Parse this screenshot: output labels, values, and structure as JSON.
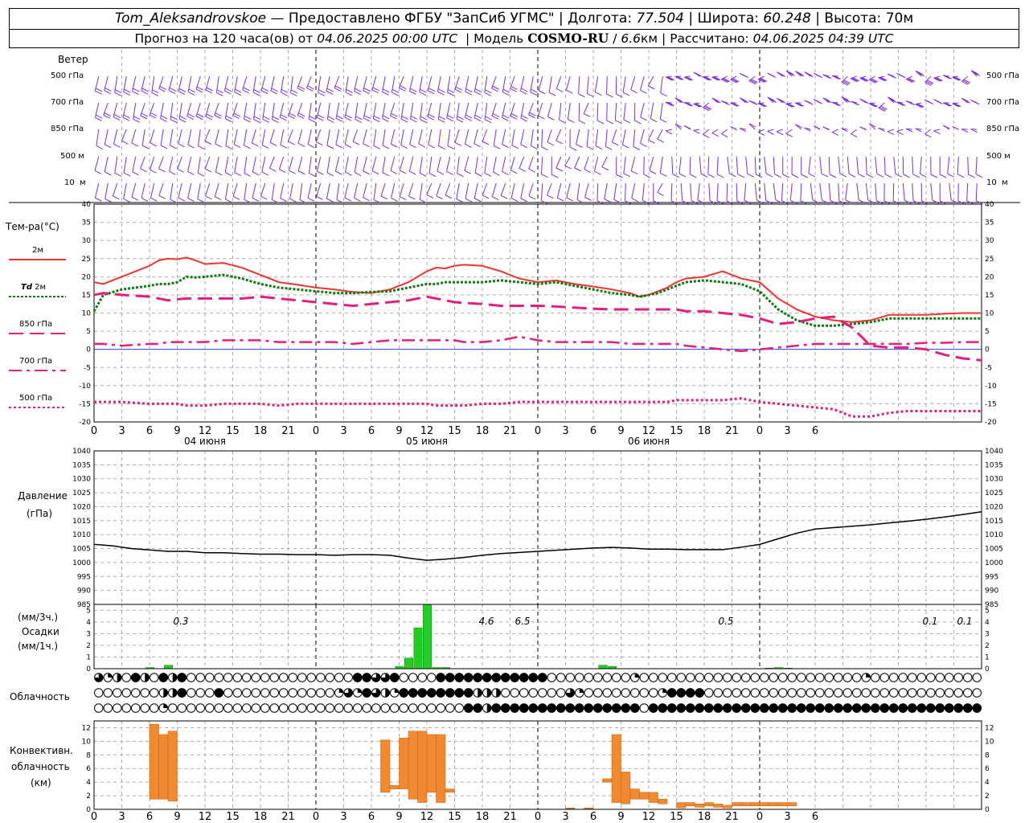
{
  "header": {
    "station": "Tom_Aleksandrovskoe",
    "provided": "— Предоставлено ФГБУ \"ЗапСиб УГМС\"",
    "lon_label": "Долгота:",
    "lon_value": "77.504",
    "lat_label": "Широта:",
    "lat_value": "60.248",
    "alt_label": "Высота:",
    "alt_value": "70м",
    "forecast_text": "Прогноз на 120 часа(ов) от",
    "forecast_time": "04.06.2025 00:00 UTC",
    "model_label": "Модель",
    "model_name": "COSMO-RU",
    "model_res_num": "6.6",
    "model_res_unit": "км",
    "computed_label": "Рассчитано:",
    "computed_time": "04.06.2025 04:39 UTC"
  },
  "labels": {
    "wind_title": "Ветер",
    "wind_levels": [
      "500 гПа",
      "700 гПа",
      "850 гПа",
      "500 м",
      "10  м"
    ],
    "temp_title": "Тем-ра(°С)",
    "legend_2m": "2м",
    "legend_td_a": "Td",
    "legend_td_b": "2м",
    "legend_850": "850 гПа",
    "legend_700": "700 гПа",
    "legend_500": "500 гПа",
    "pressure_title": "Давление",
    "pressure_unit": "(гПа)",
    "precip_unit_top": "(мм/3ч.)",
    "precip_title": "Осадки",
    "precip_unit_bottom": "(мм/1ч.)",
    "cloud_title": "Облачность",
    "conv_title_1": "Конвективн.",
    "conv_title_2": "облачность",
    "conv_unit": "(км)"
  },
  "chart_data": [
    {
      "type": "line",
      "title": "Тем-ра(°С)",
      "x_ticks": [
        "0",
        "3",
        "6",
        "9",
        "12",
        "15",
        "18",
        "21",
        "0",
        "3",
        "6",
        "9",
        "12",
        "15",
        "18",
        "21",
        "0",
        "3",
        "6",
        "9",
        "12",
        "15",
        "18",
        "21",
        "0",
        "3",
        "6"
      ],
      "day_labels": [
        "04 июня",
        "05 июня",
        "06 июня"
      ],
      "ylim": [
        -20,
        40
      ],
      "yticks": [
        -20,
        -15,
        -10,
        -5,
        0,
        5,
        10,
        15,
        20,
        25,
        30,
        35,
        40
      ],
      "grid": true,
      "x_hours": [
        0,
        1,
        3,
        6,
        7,
        8,
        9,
        10,
        11,
        12,
        14,
        16,
        18,
        20,
        22,
        24,
        26,
        28,
        30,
        32,
        34,
        35,
        36,
        37,
        38,
        39,
        40,
        42,
        44,
        46,
        48,
        50,
        52,
        54,
        56,
        58,
        59,
        60,
        61,
        62,
        63,
        64,
        66,
        68,
        70,
        72,
        74,
        76,
        78,
        80,
        82,
        84,
        86,
        88,
        90,
        92,
        94,
        96
      ],
      "series": [
        {
          "name": "2м",
          "color": "#ee3333",
          "values": [
            18.5,
            18.0,
            20.0,
            23.0,
            24.5,
            25.0,
            24.8,
            25.3,
            24.5,
            23.5,
            23.8,
            22.5,
            20.5,
            18.5,
            17.8,
            17.0,
            16.5,
            15.8,
            15.5,
            16.5,
            18.5,
            20.0,
            21.5,
            22.5,
            22.3,
            23.0,
            23.3,
            23.0,
            21.5,
            19.5,
            18.5,
            19.0,
            18.0,
            17.3,
            16.5,
            15.5,
            14.5,
            15.0,
            16.0,
            17.0,
            18.5,
            19.5,
            20.0,
            21.5,
            19.5,
            18.5,
            14.0,
            11.0,
            9.0,
            8.0,
            7.5,
            8.0,
            9.5,
            9.5,
            9.5,
            9.8,
            10.0,
            10.0
          ]
        },
        {
          "name": "Td 2м",
          "color": "#117711",
          "values": [
            10.5,
            15.0,
            16.5,
            17.5,
            18.0,
            18.0,
            18.5,
            20.0,
            19.8,
            20.0,
            20.5,
            19.5,
            18.0,
            17.0,
            16.5,
            16.0,
            15.5,
            15.5,
            15.8,
            16.0,
            17.0,
            17.5,
            18.0,
            18.0,
            18.5,
            18.5,
            18.5,
            18.5,
            19.0,
            18.5,
            18.0,
            18.5,
            17.5,
            16.5,
            15.5,
            15.0,
            14.5,
            15.0,
            15.5,
            16.5,
            17.5,
            18.5,
            19.0,
            18.5,
            18.0,
            16.0,
            11.0,
            8.0,
            6.5,
            6.5,
            7.0,
            7.5,
            8.5,
            8.5,
            8.5,
            8.5,
            8.5,
            8.5
          ]
        },
        {
          "name": "850 гПа",
          "color": "#e0207a",
          "values": [
            15.0,
            15.5,
            15.0,
            14.5,
            14.0,
            13.5,
            13.8,
            14.0,
            14.0,
            14.0,
            14.0,
            14.0,
            14.5,
            14.0,
            13.5,
            13.0,
            12.5,
            12.0,
            12.5,
            13.0,
            13.5,
            14.0,
            14.5,
            14.0,
            13.5,
            13.0,
            12.8,
            12.5,
            12.0,
            12.0,
            12.0,
            11.8,
            11.5,
            11.2,
            11.0,
            11.0,
            11.0,
            11.0,
            11.0,
            11.0,
            11.0,
            10.5,
            10.5,
            10.0,
            9.5,
            8.5,
            7.0,
            7.5,
            8.5,
            9.0,
            6.0,
            1.0,
            0.5,
            0.5,
            0.0,
            -1.5,
            -2.5,
            -3.0
          ]
        },
        {
          "name": "700 гПа",
          "color": "#e0207a",
          "values": [
            1.5,
            1.5,
            1.0,
            1.5,
            1.5,
            2.0,
            2.0,
            2.0,
            2.0,
            2.0,
            2.5,
            2.5,
            2.5,
            2.0,
            2.0,
            2.0,
            2.0,
            1.5,
            2.0,
            2.5,
            2.5,
            2.5,
            2.5,
            2.5,
            2.5,
            2.5,
            2.0,
            2.0,
            2.5,
            3.5,
            2.5,
            2.0,
            2.0,
            2.0,
            2.0,
            1.5,
            1.5,
            1.5,
            1.5,
            1.5,
            1.5,
            1.0,
            0.5,
            0.0,
            -0.5,
            0.0,
            0.5,
            1.0,
            1.5,
            1.5,
            1.5,
            1.5,
            1.5,
            1.5,
            1.8,
            1.8,
            2.0,
            2.0
          ]
        },
        {
          "name": "500 гПа",
          "color": "#e0207a",
          "values": [
            -14.5,
            -14.5,
            -14.5,
            -15.0,
            -15.0,
            -15.0,
            -15.0,
            -15.5,
            -15.5,
            -15.5,
            -15.0,
            -15.0,
            -15.0,
            -15.5,
            -15.0,
            -15.0,
            -15.0,
            -15.0,
            -15.0,
            -15.0,
            -15.0,
            -15.0,
            -15.0,
            -15.5,
            -15.5,
            -15.5,
            -15.5,
            -15.0,
            -15.0,
            -14.5,
            -14.5,
            -14.5,
            -14.5,
            -14.5,
            -14.5,
            -14.5,
            -14.5,
            -14.5,
            -14.5,
            -14.5,
            -14.0,
            -14.0,
            -14.0,
            -14.0,
            -13.5,
            -14.5,
            -15.0,
            -15.5,
            -16.0,
            -16.5,
            -18.5,
            -18.5,
            -17.5,
            -17.0,
            -17.0,
            -17.0,
            -17.0,
            -17.0
          ]
        }
      ]
    },
    {
      "type": "line",
      "title": "Давление",
      "ylabel": "(гПа)",
      "ylim": [
        985,
        1040
      ],
      "yticks": [
        985,
        990,
        995,
        1000,
        1005,
        1010,
        1015,
        1020,
        1025,
        1030,
        1035,
        1040
      ],
      "grid": true,
      "x_hours": [
        0,
        2,
        4,
        6,
        8,
        10,
        12,
        14,
        16,
        18,
        20,
        22,
        24,
        26,
        28,
        30,
        32,
        34,
        36,
        38,
        40,
        42,
        44,
        46,
        48,
        50,
        52,
        54,
        56,
        58,
        60,
        62,
        64,
        66,
        68,
        70,
        72,
        74,
        76,
        78,
        80,
        82,
        84,
        86,
        88,
        90,
        92,
        94,
        96
      ],
      "series": [
        {
          "name": "Давление",
          "color": "#000000",
          "values": [
            1006.5,
            1006,
            1005,
            1004.5,
            1004,
            1004,
            1003.5,
            1003.5,
            1003.2,
            1003,
            1003,
            1002.8,
            1002.8,
            1002.6,
            1002.8,
            1002.8,
            1002.6,
            1001.6,
            1000.8,
            1001.2,
            1001.8,
            1002.6,
            1003.2,
            1003.6,
            1004.0,
            1004.4,
            1004.8,
            1005.2,
            1005.4,
            1005.2,
            1004.8,
            1004.8,
            1004.6,
            1004.6,
            1004.6,
            1005.5,
            1006.5,
            1008.5,
            1010.5,
            1012.0,
            1012.5,
            1013.0,
            1013.5,
            1014.2,
            1014.8,
            1015.5,
            1016.3,
            1017.2,
            1018.2
          ]
        }
      ]
    },
    {
      "type": "bar",
      "title": "Осадки",
      "ylim": [
        0,
        5.5
      ],
      "yticks": [
        0,
        1,
        2,
        3,
        4,
        5
      ],
      "annotations": [
        "0.3",
        "4.6",
        "6.5",
        "0.5",
        "0.1",
        "0.1"
      ],
      "x_hours": [
        6,
        8,
        33,
        34,
        35,
        36,
        37,
        38,
        55,
        56,
        73,
        74,
        75
      ],
      "values": [
        0.1,
        0.3,
        0.2,
        0.9,
        3.5,
        5.5,
        0.1,
        0.1,
        0.3,
        0.2,
        0.05,
        0.1,
        0.05
      ],
      "color": "#22cc22"
    },
    {
      "type": "bar",
      "title": "Конвективн. облачность",
      "ylabel": "(км)",
      "ylim": [
        0,
        13
      ],
      "yticks": [
        0,
        2,
        4,
        6,
        8,
        10,
        12
      ],
      "bars": [
        {
          "h": 6,
          "bottom": 1.5,
          "top": 12.5
        },
        {
          "h": 7,
          "bottom": 1.5,
          "top": 11.0
        },
        {
          "h": 8,
          "bottom": 1.2,
          "top": 11.5
        },
        {
          "h": 31,
          "bottom": 2.5,
          "top": 10.2
        },
        {
          "h": 32,
          "bottom": 3.0,
          "top": 3.5
        },
        {
          "h": 33,
          "bottom": 3.0,
          "top": 10.5
        },
        {
          "h": 34,
          "bottom": 1.5,
          "top": 11.5
        },
        {
          "h": 35,
          "bottom": 1.0,
          "top": 11.5
        },
        {
          "h": 36,
          "bottom": 2.5,
          "top": 11.0
        },
        {
          "h": 37,
          "bottom": 1.0,
          "top": 11.0
        },
        {
          "h": 38,
          "bottom": 2.5,
          "top": 3.0
        },
        {
          "h": 51,
          "bottom": 0.1,
          "top": 0.2
        },
        {
          "h": 53,
          "bottom": 0.1,
          "top": 0.2
        },
        {
          "h": 55,
          "bottom": 4.0,
          "top": 4.5
        },
        {
          "h": 56,
          "bottom": 1.0,
          "top": 11.0
        },
        {
          "h": 57,
          "bottom": 0.8,
          "top": 5.5
        },
        {
          "h": 58,
          "bottom": 1.5,
          "top": 3.0
        },
        {
          "h": 59,
          "bottom": 1.5,
          "top": 2.5
        },
        {
          "h": 60,
          "bottom": 1.0,
          "top": 2.5
        },
        {
          "h": 61,
          "bottom": 0.8,
          "top": 1.5
        },
        {
          "h": 63,
          "bottom": 0.2,
          "top": 1.0
        },
        {
          "h": 64,
          "bottom": 0.5,
          "top": 1.0
        },
        {
          "h": 65,
          "bottom": 0.3,
          "top": 0.8
        },
        {
          "h": 66,
          "bottom": 0.5,
          "top": 1.0
        },
        {
          "h": 67,
          "bottom": 0.3,
          "top": 0.8
        },
        {
          "h": 68,
          "bottom": 0.2,
          "top": 0.6
        },
        {
          "h": 69,
          "bottom": 0.5,
          "top": 1.0
        },
        {
          "h": 70,
          "bottom": 0.5,
          "top": 1.0
        },
        {
          "h": 71,
          "bottom": 0.5,
          "top": 1.0
        },
        {
          "h": 72,
          "bottom": 0.5,
          "top": 1.0
        },
        {
          "h": 73,
          "bottom": 0.5,
          "top": 1.0
        },
        {
          "h": 74,
          "bottom": 0.5,
          "top": 1.0
        },
        {
          "h": 75,
          "bottom": 0.5,
          "top": 1.0
        }
      ],
      "color": "#f08a30"
    },
    {
      "type": "table",
      "title": "Облачность",
      "rows": [
        "eeeeeeeeeeeeeeeeeeeeeeeeeeeeeeeeeeeeeeeeeeeeeeeeeeeeeeeeeeeeeeeeeeeeeeeeeeeeeeeeeeeeeeeeeeeeeeeeeeeeee",
        "eeeeeeeeeeeeeeeeeeeeeeeeeeeeeeeeeeeeeeeeeeeeeeeeeeeeeeeeeeeeeeeeeeeeeeeeeeeeeeeeeeeeeeeeeeeeeeeeeeeeeeeeeeeeeeeeeeee",
        "eeeeeeeeeeeeeeeeeeeeeeeeeeeeeeeeeeeeeeeeeeeeeeeeeeeeeeeeeeeeeeeeeeeeeeeeeeeeeeeeeeeeeeeeeeeeeeeeeeeeeeeeeeeeeeeeeeee"
      ],
      "row_codes": [
        "tqhefhefhfeeeeeeeeeeeeeeeeeeffttfeeeeffffffffffffeeeeeeeeeqeeeeeeeeeeeeeeeeeeeeeeeeqeeeeeeeeeeeeeeeeeeee",
        "eeeeeeehhfeeefeeeeeeeeeeeeqtqfthqffffffffhhheeeeeeetqeeeeeeeeqffffeeeeeeeeeeeeeeeeeeeeeeeeeeeeeeeeeeff",
        "eeeeeeeqeeeeeeeeeeeeeeeeeeeeeeeeeeeeeeeeffhffffffffffffffffeffffffffffffffffffffffffffffffffffffffff"
      ]
    }
  ]
}
